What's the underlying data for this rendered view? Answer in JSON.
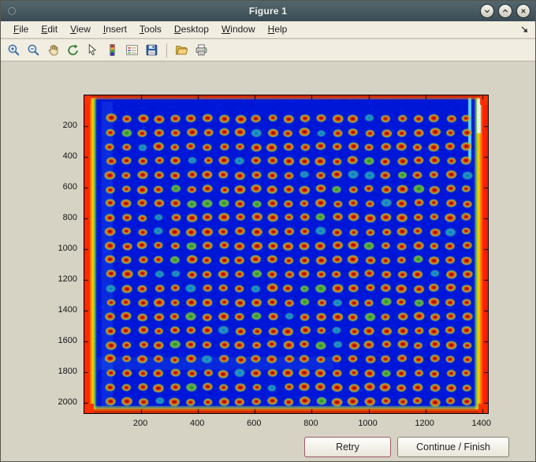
{
  "window": {
    "title": "Figure 1",
    "controls": [
      {
        "name": "minimize"
      },
      {
        "name": "maximize"
      },
      {
        "name": "close"
      }
    ]
  },
  "menu": {
    "items": [
      {
        "label": "File"
      },
      {
        "label": "Edit"
      },
      {
        "label": "View"
      },
      {
        "label": "Insert"
      },
      {
        "label": "Tools"
      },
      {
        "label": "Desktop"
      },
      {
        "label": "Window"
      },
      {
        "label": "Help"
      }
    ]
  },
  "toolbar": {
    "groups": [
      [
        "zoom-in",
        "zoom-out",
        "pan",
        "rotate-3d",
        "data-cursor",
        "colorbar",
        "legend",
        "save"
      ],
      [
        "open",
        "print"
      ]
    ]
  },
  "actions": {
    "retry_label": "Retry",
    "continue_label": "Continue / Finish"
  },
  "chart_data": {
    "type": "heatmap",
    "title": "",
    "xlabel": "",
    "ylabel": "",
    "x_ticks": [
      200,
      400,
      600,
      800,
      1000,
      1200,
      1400
    ],
    "y_ticks": [
      200,
      400,
      600,
      800,
      1000,
      1200,
      1400,
      1600,
      1800,
      2000
    ],
    "x_range": [
      0,
      1420
    ],
    "y_range": [
      0,
      2065
    ],
    "grid": false,
    "legend": false,
    "description": "Jet-colormap pseudocolor image of a scanned microarray plate: dark blue background with a regular grid of red/orange spots surrounded by yellow-green halos; saturated red/orange bands along all four image edges with yellow fringes and a cyan streak near the top-right edge.",
    "spot_grid": {
      "rows": 21,
      "cols": 23,
      "x_start": 92,
      "x_step": 57,
      "y_start": 150,
      "y_step": 92
    },
    "colors": {
      "background": "#0017d8",
      "spot_core": "#cc2200",
      "spot_mid": "#f07818",
      "spot_ring": "#8cd73c",
      "weak_spot": "#28c8be",
      "edge": "#e63000",
      "edge_fringe": "#ffdf00"
    }
  }
}
